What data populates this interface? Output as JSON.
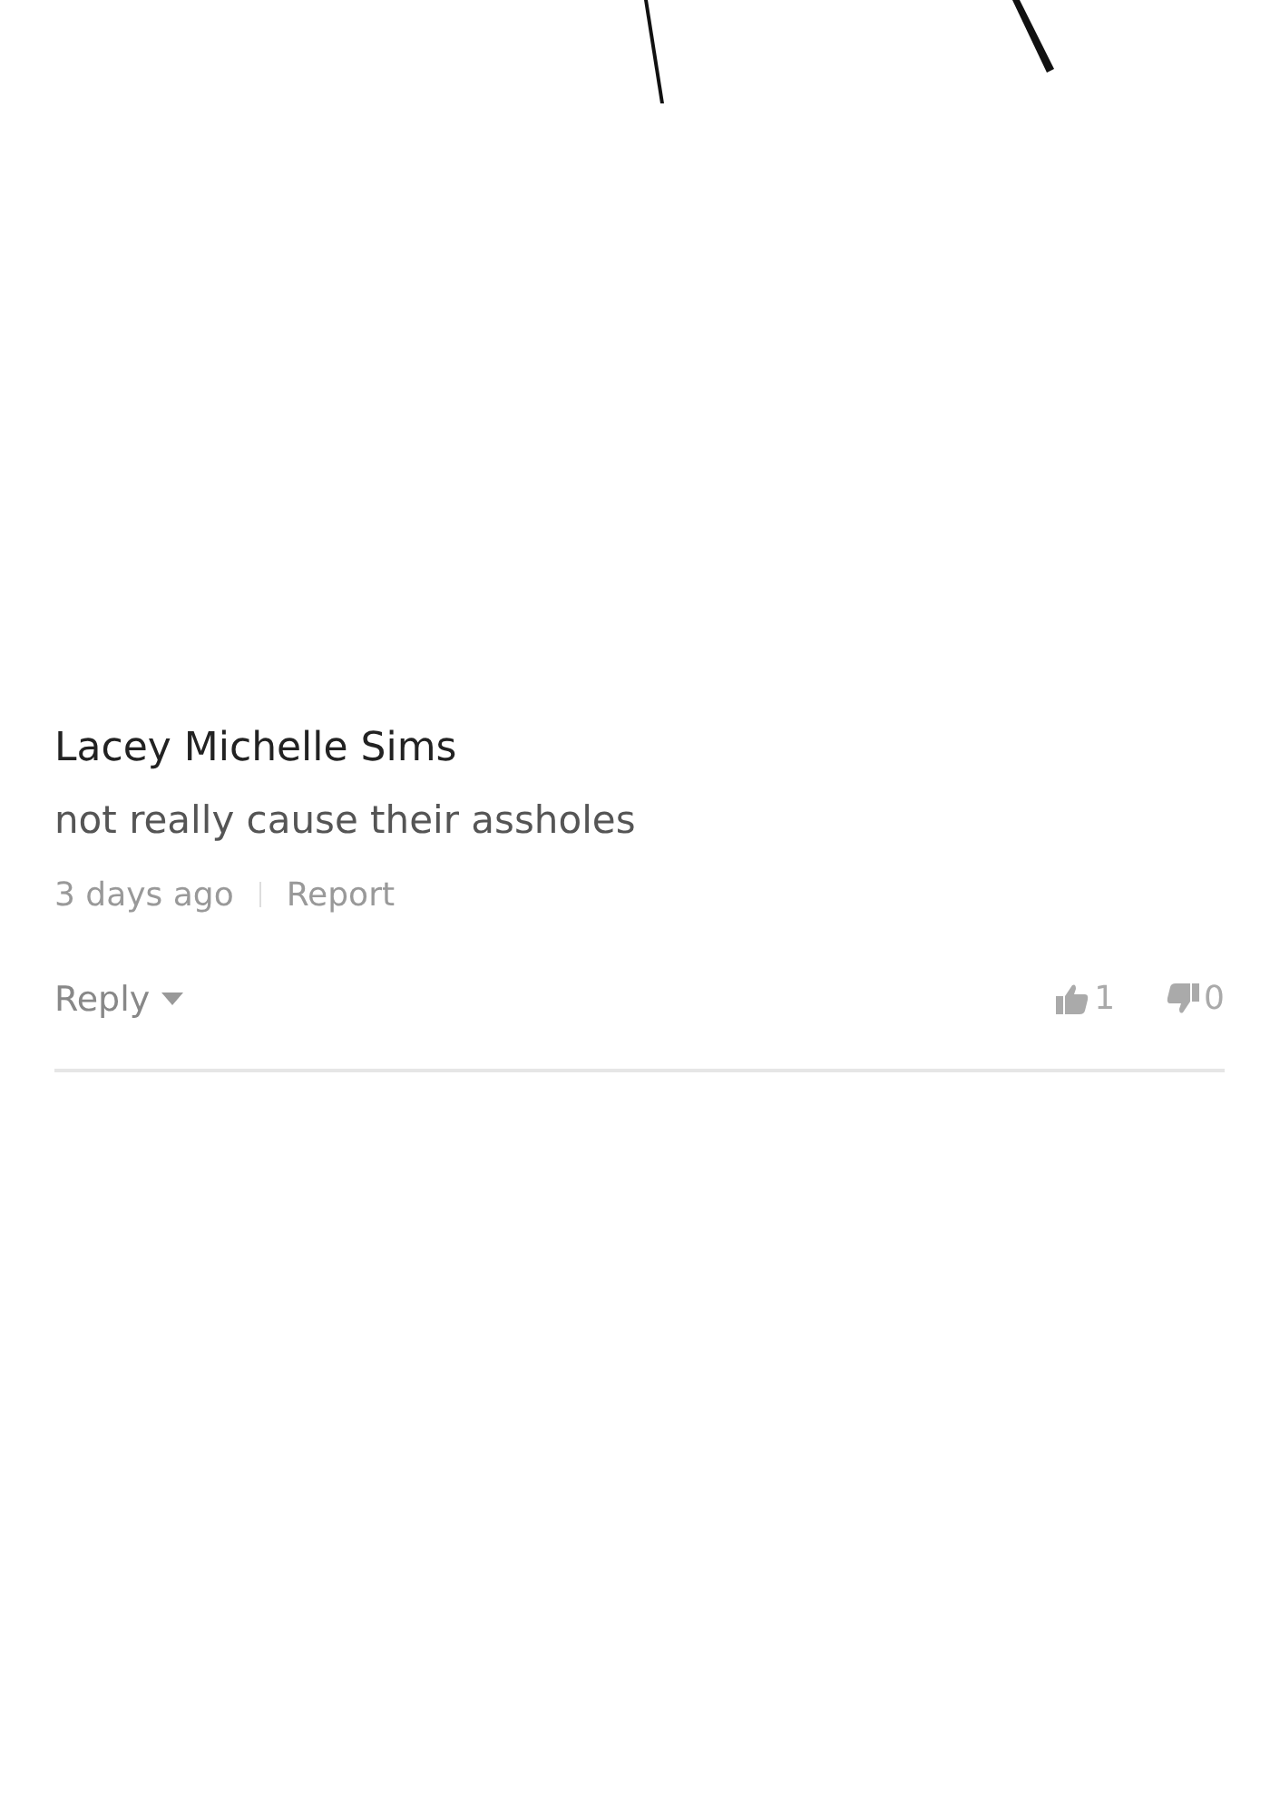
{
  "artwork": {
    "kind": "drawing"
  },
  "comment": {
    "author": "Lacey Michelle Sims",
    "text": "not really cause their assholes",
    "time": "3 days ago",
    "report": "Report",
    "reply": "Reply",
    "likes": "1",
    "dislikes": "0"
  }
}
